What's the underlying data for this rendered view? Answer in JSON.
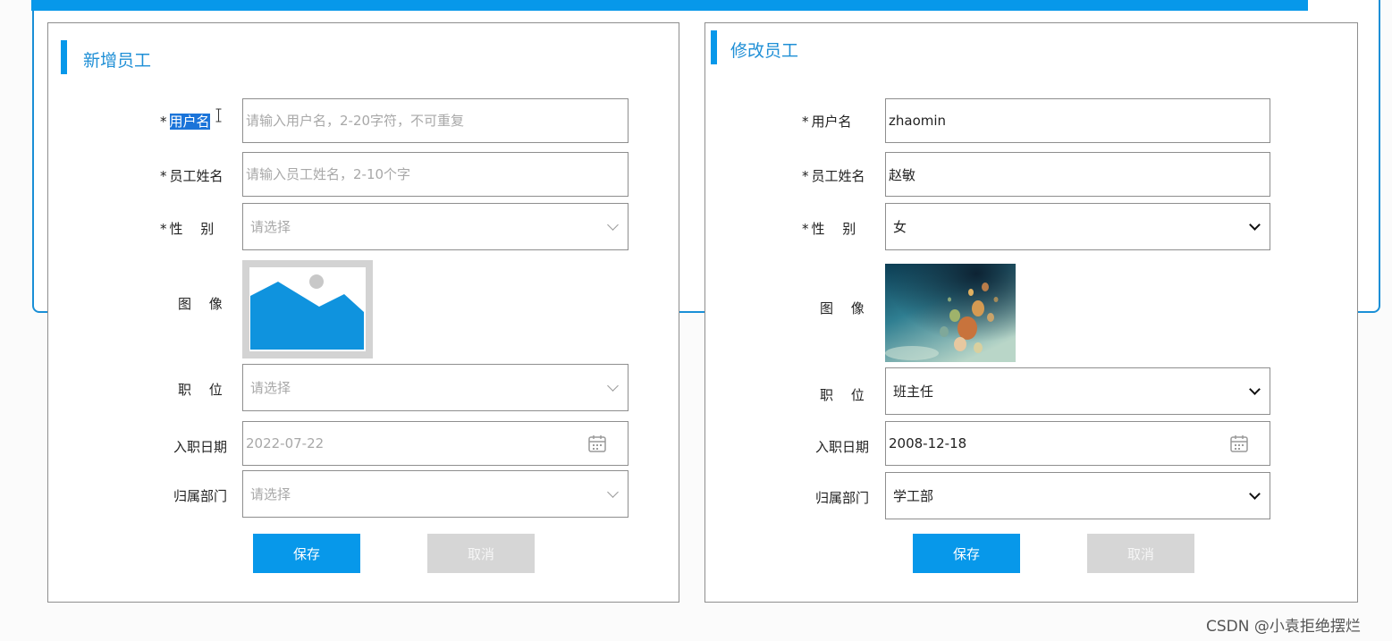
{
  "add_form": {
    "title": "新增员工",
    "username": {
      "required": "*",
      "label": "用户名",
      "placeholder": "请输入用户名，2-20字符，不可重复"
    },
    "name": {
      "required": "*",
      "label": "员工姓名",
      "placeholder": "请输入员工姓名，2-10个字"
    },
    "gender": {
      "required": "*",
      "label": "性　 别",
      "placeholder": "请选择"
    },
    "avatar": {
      "label": "图　 像"
    },
    "position": {
      "label": "职　 位",
      "placeholder": "请选择"
    },
    "hire_date": {
      "label": "入职日期",
      "value": "2022-07-22"
    },
    "department": {
      "label": "归属部门",
      "placeholder": "请选择"
    },
    "save_label": "保存",
    "cancel_label": "取消"
  },
  "edit_form": {
    "title": "修改员工",
    "username": {
      "required": "*",
      "label": "用户名",
      "value": "zhaomin"
    },
    "name": {
      "required": "*",
      "label": "员工姓名",
      "value": "赵敏"
    },
    "gender": {
      "required": "*",
      "label": "性　 别",
      "value": "女"
    },
    "avatar": {
      "label": "图　 像"
    },
    "position": {
      "label": "职　 位",
      "value": "班主任"
    },
    "hire_date": {
      "label": "入职日期",
      "value": "2008-12-18"
    },
    "department": {
      "label": "归属部门",
      "value": "学工部"
    },
    "save_label": "保存",
    "cancel_label": "取消"
  },
  "watermark": "CSDN @小袁拒绝摆烂",
  "colors": {
    "accent": "#0798ea",
    "title": "#1f8fd6",
    "cancel": "#d6d6d6",
    "placeholder": "#a8a8a8"
  },
  "icons": {
    "calendar": "calendar-icon",
    "dropdown": "chevron-down-icon",
    "image": "image-placeholder-icon"
  }
}
